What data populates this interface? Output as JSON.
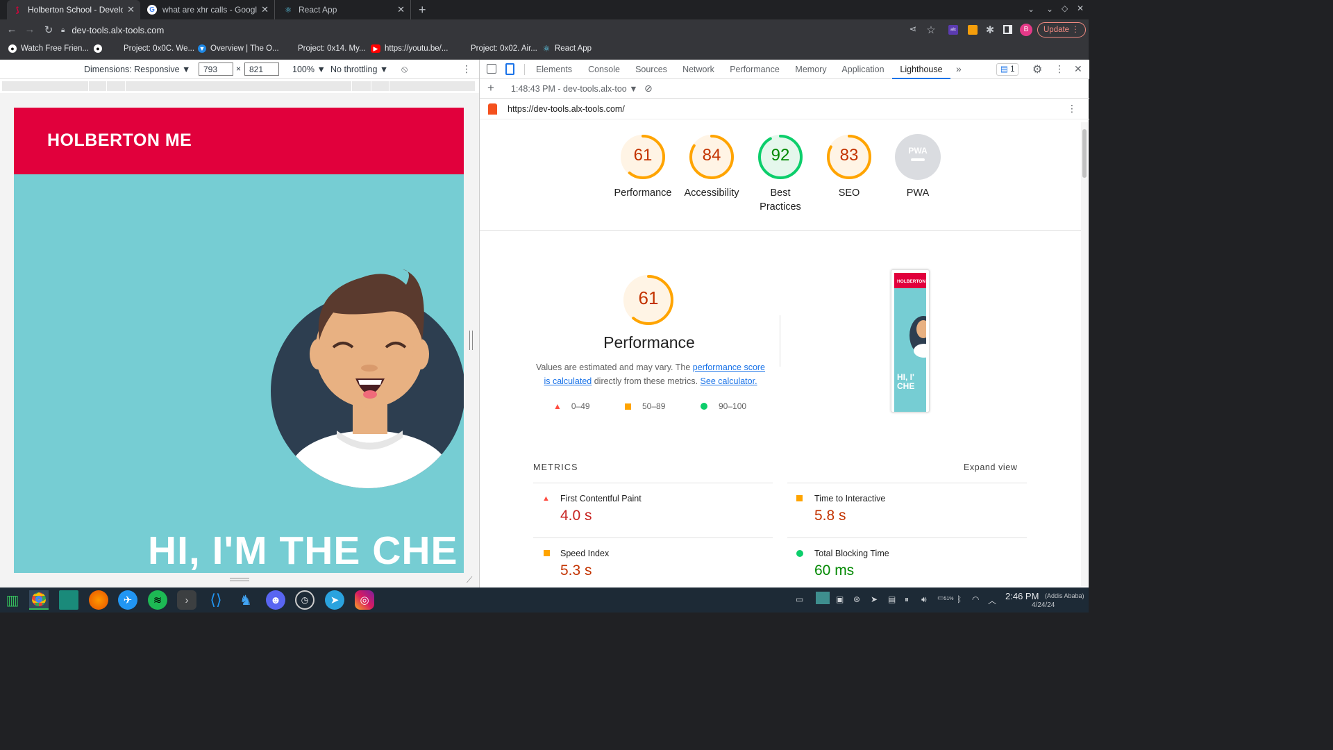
{
  "browser": {
    "tabs": [
      {
        "title": "Holberton School - Developer",
        "icon": "holberton-icon"
      },
      {
        "title": "what are xhr calls - Google Se",
        "icon": "google-icon"
      },
      {
        "title": "React App",
        "icon": "react-icon"
      }
    ],
    "url": "dev-tools.alx-tools.com",
    "update_label": "Update",
    "profile_initial": "B",
    "bookmarks": [
      "Watch Free Frien...",
      "Project: 0x0C. We...",
      "Overview | The O...",
      "Project: 0x14. My...",
      "https://youtu.be/...",
      "Project: 0x02. Air...",
      "React App"
    ]
  },
  "device_toolbar": {
    "dimensions_label": "Dimensions: Responsive",
    "width": "793",
    "height": "821",
    "times": "×",
    "zoom": "100%",
    "throttle": "No throttling"
  },
  "page": {
    "brand": "HOLBERTON ME",
    "headline": "HI, I'M THE CHE"
  },
  "devtools": {
    "tabs": [
      "Elements",
      "Console",
      "Sources",
      "Network",
      "Performance",
      "Memory",
      "Application",
      "Lighthouse"
    ],
    "selected_tab": "Lighthouse",
    "issues_count": "1",
    "report_time": "1:48:43 PM - dev-tools.alx-too",
    "report_url": "https://dev-tools.alx-tools.com/",
    "scores": [
      {
        "label": "Performance",
        "value": "61",
        "score": 61,
        "color": "#ffa400",
        "text_color": "#c33300"
      },
      {
        "label": "Accessibility",
        "value": "84",
        "score": 84,
        "color": "#ffa400",
        "text_color": "#c33300"
      },
      {
        "label": "Best Practices",
        "value": "92",
        "score": 92,
        "color": "#0cce6b",
        "text_color": "#008800"
      },
      {
        "label": "SEO",
        "value": "83",
        "score": 83,
        "color": "#ffa400",
        "text_color": "#c33300"
      },
      {
        "label": "PWA",
        "value": "PWA",
        "score": 0,
        "color": "#dadce0",
        "text_color": "#ffffff"
      }
    ],
    "perf": {
      "value": "61",
      "title": "Performance",
      "desc_prefix": "Values are estimated and may vary. The",
      "link1": "performance score is calculated",
      "desc_mid": "directly from these metrics.",
      "link2": "See calculator.",
      "legend": [
        "0–49",
        "50–89",
        "90–100"
      ]
    },
    "screenshot_thumb": {
      "brand": "HOLBERTON",
      "headline": "HI, I' CHE"
    },
    "metrics_title": "METRICS",
    "expand_label": "Expand view",
    "metrics": [
      {
        "name": "First Contentful Paint",
        "value": "4.0 s",
        "status": "fail"
      },
      {
        "name": "Time to Interactive",
        "value": "5.8 s",
        "status": "average"
      },
      {
        "name": "Speed Index",
        "value": "5.3 s",
        "status": "average"
      },
      {
        "name": "Total Blocking Time",
        "value": "60 ms",
        "status": "pass"
      }
    ]
  },
  "taskbar": {
    "time": "2:46 PM",
    "timezone": "(Addis Ababa)",
    "date": "4/24/24",
    "battery": "51%"
  },
  "colors": {
    "fail": "#ff4e42",
    "average": "#ffa400",
    "pass": "#0cce6b",
    "fail_text": "#c33300",
    "pass_text": "#008800",
    "link": "#1a73e8",
    "page_red": "#e1003c",
    "page_teal": "#76cdd3"
  }
}
